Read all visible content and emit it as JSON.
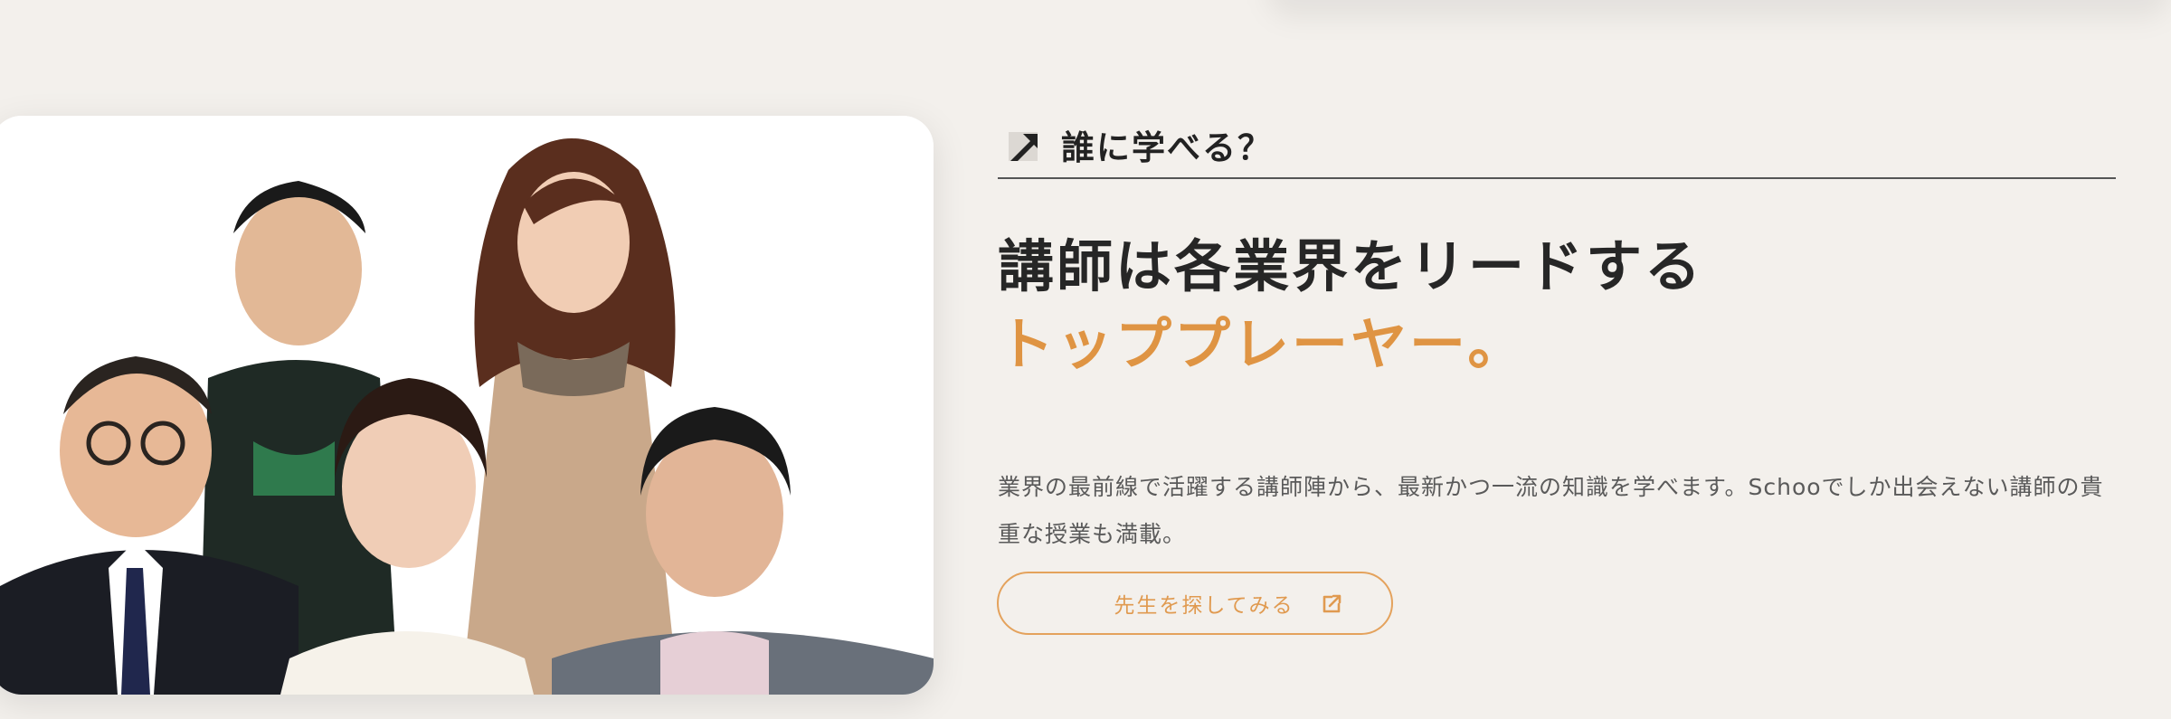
{
  "section": {
    "label": "誰に学べる？",
    "label_icon": "diagonal-arrow-icon"
  },
  "headline": {
    "line1": "講師は各業界をリードする",
    "line2": "トッププレーヤー。"
  },
  "description": "業界の最前線で活躍する講師陣から、最新かつ一流の知識を学べます。Schooでしか出会えない講師の貴重な授業も満載。",
  "cta": {
    "label": "先生を探してみる",
    "icon": "external-link-icon"
  },
  "colors": {
    "background": "#f3f0ec",
    "accent": "#df9443",
    "text": "#262626",
    "muted": "#5a5a5a"
  }
}
